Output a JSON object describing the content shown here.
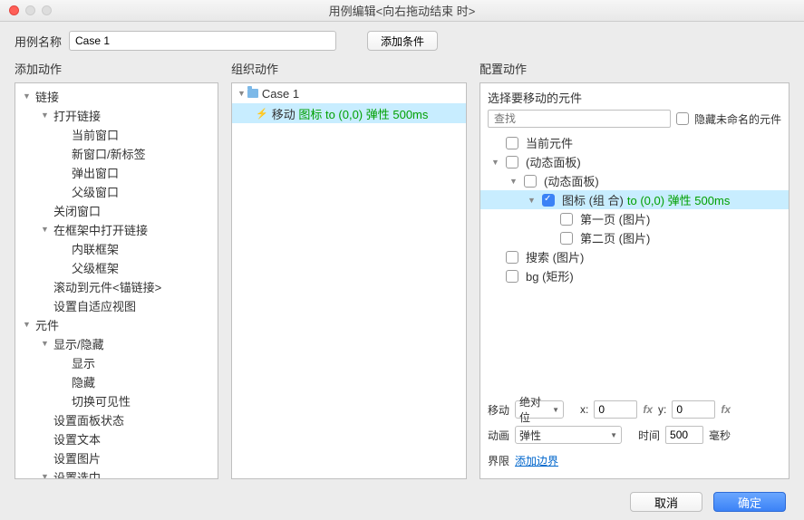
{
  "window_title": "用例编辑<向右拖动结束 时>",
  "header": {
    "name_label": "用例名称",
    "name_value": "Case 1",
    "add_condition": "添加条件"
  },
  "columns": {
    "add_action": "添加动作",
    "org_action": "组织动作",
    "cfg_action": "配置动作"
  },
  "tree": [
    {
      "indent": 0,
      "caret": "down",
      "label": "链接"
    },
    {
      "indent": 1,
      "caret": "down",
      "label": "打开链接"
    },
    {
      "indent": 2,
      "caret": "",
      "label": "当前窗口"
    },
    {
      "indent": 2,
      "caret": "",
      "label": "新窗口/新标签"
    },
    {
      "indent": 2,
      "caret": "",
      "label": "弹出窗口"
    },
    {
      "indent": 2,
      "caret": "",
      "label": "父级窗口"
    },
    {
      "indent": 1,
      "caret": "",
      "label": "关闭窗口"
    },
    {
      "indent": 1,
      "caret": "down",
      "label": "在框架中打开链接"
    },
    {
      "indent": 2,
      "caret": "",
      "label": "内联框架"
    },
    {
      "indent": 2,
      "caret": "",
      "label": "父级框架"
    },
    {
      "indent": 1,
      "caret": "",
      "label": "滚动到元件<锚链接>"
    },
    {
      "indent": 1,
      "caret": "",
      "label": "设置自适应视图"
    },
    {
      "indent": 0,
      "caret": "down",
      "label": "元件"
    },
    {
      "indent": 1,
      "caret": "down",
      "label": "显示/隐藏"
    },
    {
      "indent": 2,
      "caret": "",
      "label": "显示"
    },
    {
      "indent": 2,
      "caret": "",
      "label": "隐藏"
    },
    {
      "indent": 2,
      "caret": "",
      "label": "切换可见性"
    },
    {
      "indent": 1,
      "caret": "",
      "label": "设置面板状态"
    },
    {
      "indent": 1,
      "caret": "",
      "label": "设置文本"
    },
    {
      "indent": 1,
      "caret": "",
      "label": "设置图片"
    },
    {
      "indent": 1,
      "caret": "down",
      "label": "设置选中"
    }
  ],
  "org": {
    "root": "Case 1",
    "child_prefix": "移动",
    "child_target": "图标 to (0,0) 弹性 500ms"
  },
  "cfg": {
    "select_label": "选择要移动的元件",
    "search_placeholder": "查找",
    "hide_unnamed": "隐藏未命名的元件",
    "widgets": [
      {
        "indent": 0,
        "caret": "",
        "check": false,
        "label": "当前元件"
      },
      {
        "indent": 0,
        "caret": "down",
        "check": false,
        "label": "(动态面板)"
      },
      {
        "indent": 1,
        "caret": "down",
        "check": false,
        "label": "(动态面板)"
      },
      {
        "indent": 2,
        "caret": "down",
        "check": true,
        "label": "图标 (组 合)",
        "extra": "to (0,0) 弹性 500ms",
        "sel": true
      },
      {
        "indent": 3,
        "caret": "",
        "check": false,
        "label": "第一页 (图片)"
      },
      {
        "indent": 3,
        "caret": "",
        "check": false,
        "label": "第二页 (图片)"
      },
      {
        "indent": 0,
        "caret": "",
        "check": false,
        "label": "搜索 (图片)"
      },
      {
        "indent": 0,
        "caret": "",
        "check": false,
        "label": "bg (矩形)"
      }
    ],
    "move_label": "移动",
    "move_mode": "绝对位",
    "x_label": "x:",
    "x_val": "0",
    "y_label": "y:",
    "y_val": "0",
    "anim_label": "动画",
    "anim_mode": "弹性",
    "time_label": "时间",
    "time_val": "500",
    "ms": "毫秒",
    "bounds_label": "界限",
    "add_bounds": "添加边界"
  },
  "footer": {
    "cancel": "取消",
    "ok": "确定"
  }
}
